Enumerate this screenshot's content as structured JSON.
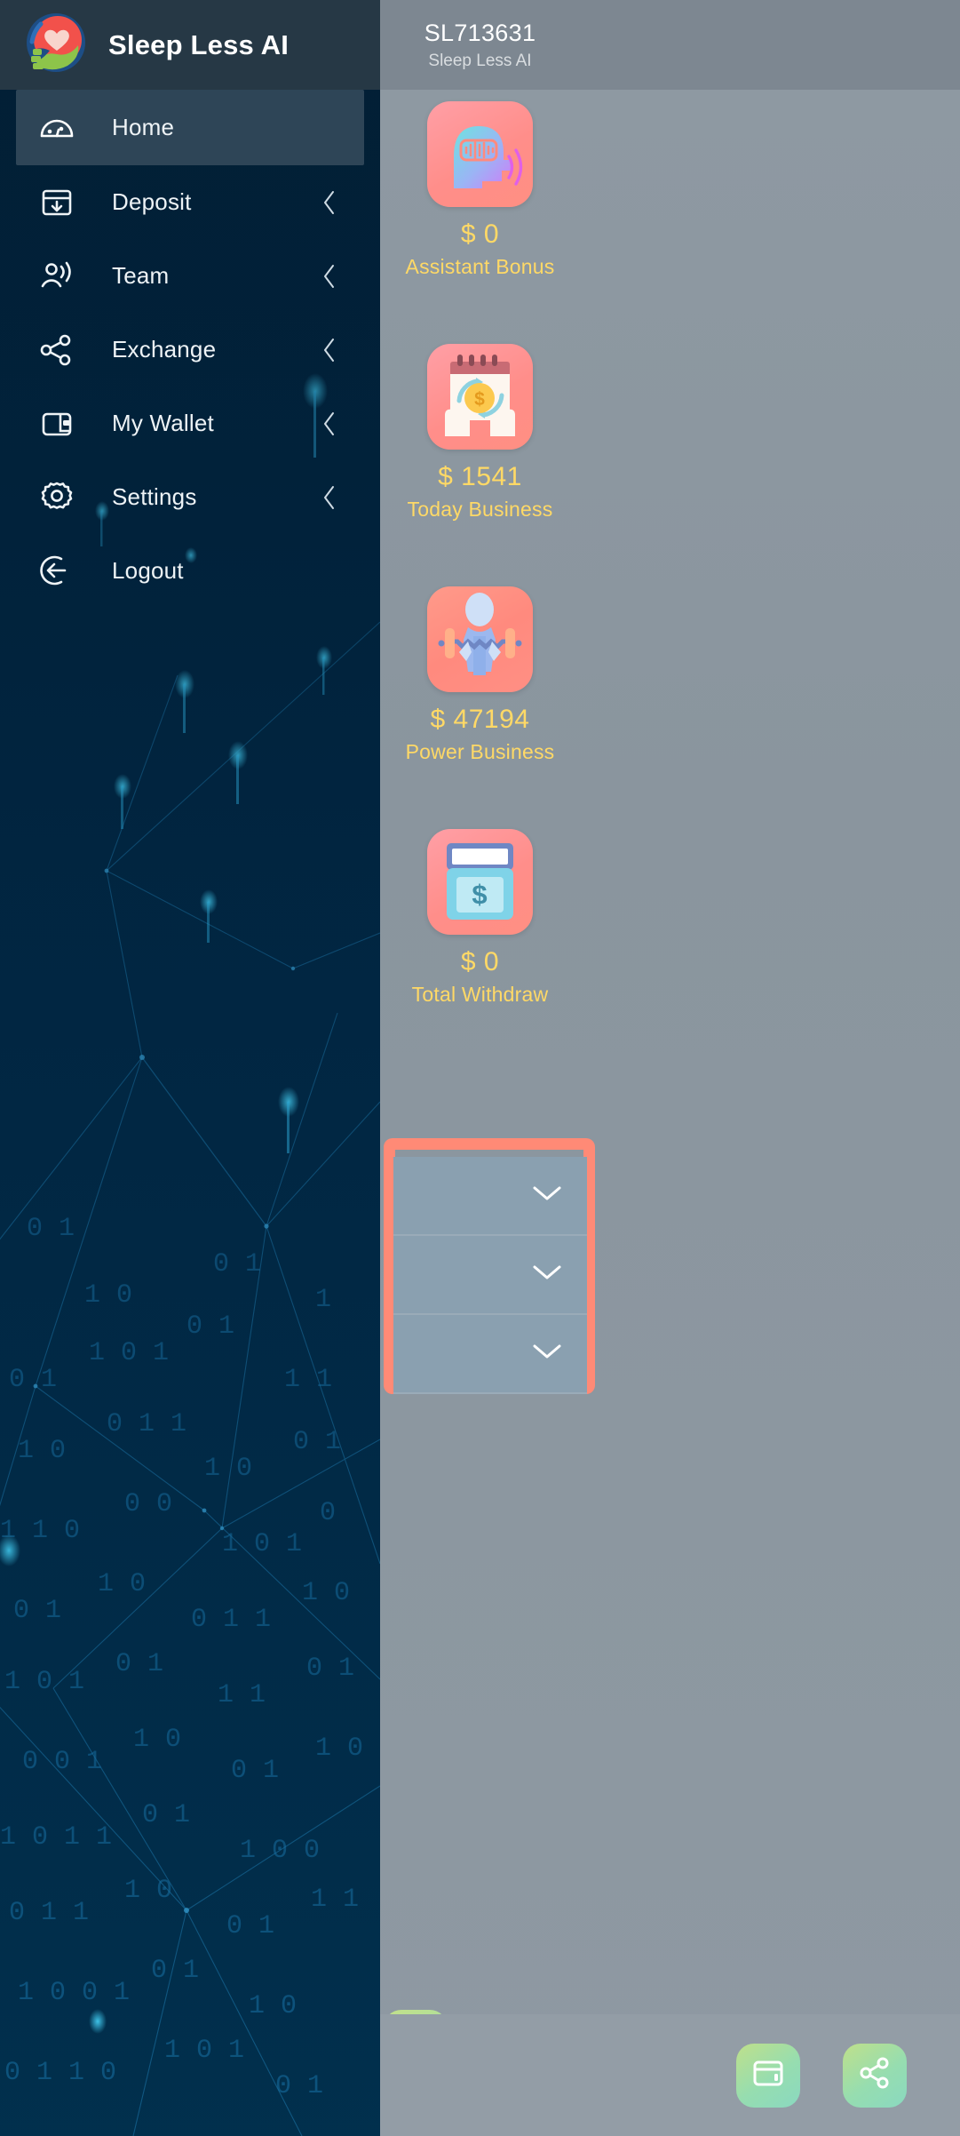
{
  "brand": {
    "name": "Sleep Less AI",
    "logo_icon": "heart-hand-logo"
  },
  "account": {
    "id": "SL713631",
    "app_name": "Sleep Less AI"
  },
  "sidebar": {
    "items": [
      {
        "label": "Home",
        "icon": "dashboard-gauge-icon",
        "has_chevron": false,
        "active": true
      },
      {
        "label": "Deposit",
        "icon": "deposit-box-icon",
        "has_chevron": true,
        "active": false
      },
      {
        "label": "Team",
        "icon": "team-broadcast-icon",
        "has_chevron": true,
        "active": false
      },
      {
        "label": "Exchange",
        "icon": "share-nodes-icon",
        "has_chevron": true,
        "active": false
      },
      {
        "label": "My Wallet",
        "icon": "wallet-icon",
        "has_chevron": true,
        "active": false
      },
      {
        "label": "Settings",
        "icon": "gear-icon",
        "has_chevron": true,
        "active": false
      },
      {
        "label": "Logout",
        "icon": "logout-arrow-icon",
        "has_chevron": false,
        "active": false
      }
    ]
  },
  "stats": [
    {
      "value": "$ 0",
      "label": "Assistant Bonus",
      "icon": "head-soundwave-icon"
    },
    {
      "value": "$ 1541",
      "label": "Today Business",
      "icon": "hands-coin-icon"
    },
    {
      "value": "$ 47194",
      "label": "Power Business",
      "icon": "weightlifter-icon"
    },
    {
      "value": "$ 0",
      "label": "Total Withdraw",
      "icon": "atm-cash-icon"
    }
  ],
  "accordion": {
    "rows": [
      {
        "chevron_icon": "chevron-down-icon"
      },
      {
        "chevron_icon": "chevron-down-icon"
      },
      {
        "chevron_icon": "chevron-down-icon"
      }
    ]
  },
  "bottom_nav": {
    "items": [
      {
        "icon": "graduation-cap-icon"
      },
      {
        "icon": "wallet-icon"
      },
      {
        "icon": "share-nodes-icon"
      }
    ]
  },
  "colors": {
    "accent_yellow": "#ffd966",
    "accent_salmon": "#ff8a76",
    "drawer_bg": "#012138",
    "drawer_header": "#263845",
    "page_bg": "#8f9aa3"
  }
}
